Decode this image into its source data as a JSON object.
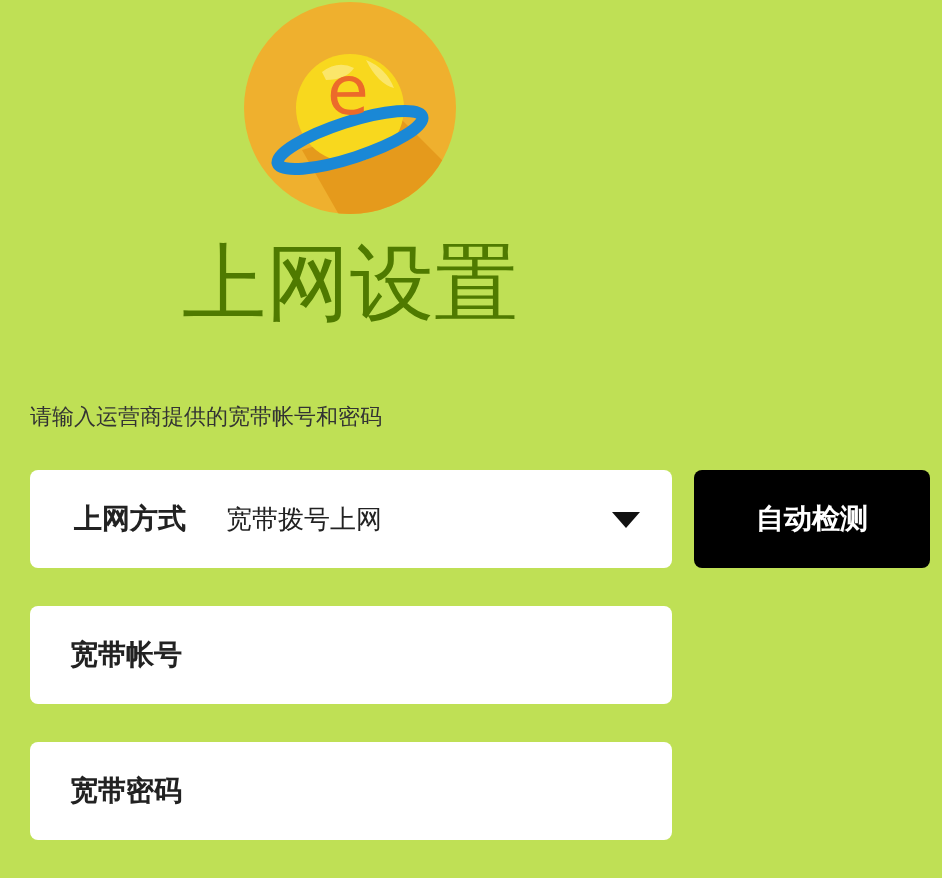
{
  "logo": {
    "glyph": "e"
  },
  "title": "上网设置",
  "instruction": "请输入运营商提供的宽带帐号和密码",
  "connection_type": {
    "label": "上网方式",
    "value": "宽带拨号上网"
  },
  "detect_button": "自动检测",
  "fields": [
    {
      "placeholder": "宽带帐号"
    },
    {
      "placeholder": "宽带密码"
    }
  ]
}
